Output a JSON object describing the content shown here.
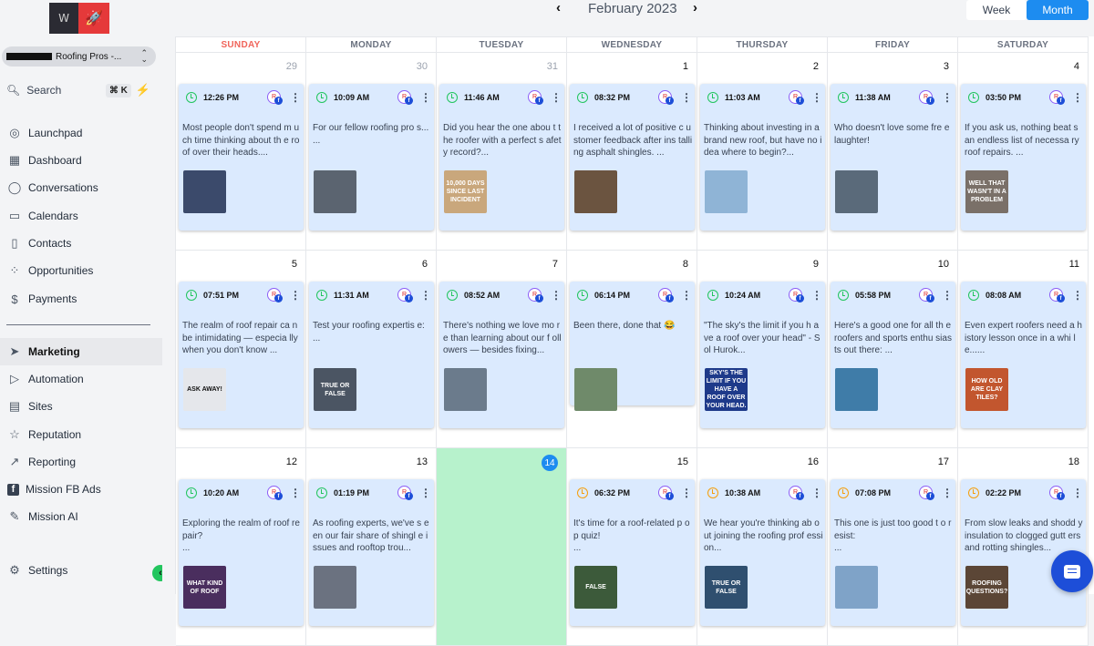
{
  "sidebar": {
    "logo_text": "W",
    "account": "Roofing Pros -...",
    "search_label": "Search",
    "search_shortcut": "⌘ K",
    "nav": [
      {
        "label": "Launchpad",
        "icon": "launchpad-icon"
      },
      {
        "label": "Dashboard",
        "icon": "dashboard-icon"
      },
      {
        "label": "Conversations",
        "icon": "chat-icon"
      },
      {
        "label": "Calendars",
        "icon": "calendar-icon"
      },
      {
        "label": "Contacts",
        "icon": "contacts-icon"
      },
      {
        "label": "Opportunities",
        "icon": "opportunities-icon"
      },
      {
        "label": "Payments",
        "icon": "payments-icon"
      }
    ],
    "nav2": [
      {
        "label": "Marketing",
        "icon": "send-icon",
        "active": true
      },
      {
        "label": "Automation",
        "icon": "automation-icon"
      },
      {
        "label": "Sites",
        "icon": "sites-icon"
      },
      {
        "label": "Reputation",
        "icon": "star-icon"
      },
      {
        "label": "Reporting",
        "icon": "reporting-icon"
      },
      {
        "label": "Mission FB Ads",
        "icon": "facebook-icon"
      },
      {
        "label": "Mission AI",
        "icon": "pencil-icon"
      }
    ],
    "settings_label": "Settings"
  },
  "header": {
    "month_label": "February 2023",
    "week_label": "Week",
    "month_button": "Month"
  },
  "days_of_week": [
    "SUNDAY",
    "MONDAY",
    "TUESDAY",
    "WEDNESDAY",
    "THURSDAY",
    "FRIDAY",
    "SATURDAY"
  ],
  "weeks": [
    [
      {
        "day": "29",
        "other": true,
        "post": {
          "time": "12:26 PM",
          "text": "Most people don't spend m uch time thinking about th e roof over their heads....",
          "img_text": "",
          "img_color": "#3b4a6b",
          "status": "green"
        }
      },
      {
        "day": "30",
        "other": true,
        "post": {
          "time": "10:09 AM",
          "text": "For our fellow roofing pro s...\n...",
          "img_text": "",
          "img_color": "#5b6470",
          "status": "green"
        }
      },
      {
        "day": "31",
        "other": true,
        "post": {
          "time": "11:46 AM",
          "text": "Did you hear the one abou t the roofer with a perfect s afety record?...",
          "img_text": "10,000 DAYS SINCE LAST INCIDENT",
          "img_color": "#c9a77c",
          "status": "green"
        }
      },
      {
        "day": "1",
        "post": {
          "time": "08:32 PM",
          "text": "I received a lot of positive c ustomer feedback after ins talling asphalt shingles. ...",
          "img_text": "",
          "img_color": "#6b5440",
          "status": "green"
        }
      },
      {
        "day": "2",
        "post": {
          "time": "11:03 AM",
          "text": "Thinking about investing in a brand new roof, but have no idea where to begin?...",
          "img_text": "",
          "img_color": "#8fb4d6",
          "status": "green"
        }
      },
      {
        "day": "3",
        "post": {
          "time": "11:38 AM",
          "text": "Who doesn't love some fre e laughter!",
          "img_text": "",
          "img_color": "#5a6a7a",
          "status": "green"
        }
      },
      {
        "day": "4",
        "post": {
          "time": "03:50 PM",
          "text": "If you ask us, nothing beat s an endless list of necessa ry roof repairs. ...",
          "img_text": "WELL THAT WASN'T IN A PROBLEM",
          "img_color": "#7a7068",
          "status": "green"
        }
      }
    ],
    [
      {
        "day": "5",
        "post": {
          "time": "07:51 PM",
          "text": "The realm of roof repair ca n be intimidating — especia lly when you don't know ...",
          "img_text": "ASK AWAY!",
          "img_color": "#e5e7eb",
          "status": "green"
        }
      },
      {
        "day": "6",
        "post": {
          "time": "11:31 AM",
          "text": "Test your roofing expertis e:\n...",
          "img_text": "TRUE OR FALSE",
          "img_color": "#4b5563",
          "status": "green"
        }
      },
      {
        "day": "7",
        "post": {
          "time": "08:52 AM",
          "text": "There's nothing we love mo re than learning about our f ollowers — besides fixing...",
          "img_text": "",
          "img_color": "#6b7b8c",
          "status": "green"
        }
      },
      {
        "day": "8",
        "post": {
          "time": "06:14 PM",
          "text": "Been there, done that 😂",
          "img_text": "",
          "img_color": "#6f8a6a",
          "status": "green"
        }
      },
      {
        "day": "9",
        "post": {
          "time": "10:24 AM",
          "text": "\"The sky's the limit if you h ave a roof over your head\" - Sol Hurok...",
          "img_text": "SKY'S THE LIMIT IF YOU HAVE A ROOF OVER YOUR HEAD.",
          "img_color": "#1e3a8a",
          "status": "green"
        }
      },
      {
        "day": "10",
        "post": {
          "time": "05:58 PM",
          "text": "Here's a good one for all th e roofers and sports enthu siasts out there: ...",
          "img_text": "",
          "img_color": "#3f7ca8",
          "status": "green"
        }
      },
      {
        "day": "11",
        "post": {
          "time": "08:08 AM",
          "text": "Even expert roofers need a history lesson once in a whi le......",
          "img_text": "HOW OLD ARE CLAY TILES?",
          "img_color": "#c2562e",
          "status": "green"
        }
      }
    ],
    [
      {
        "day": "12",
        "post": {
          "time": "10:20 AM",
          "text": "Exploring the realm of roof repair?\n...",
          "img_text": "WHAT KIND OF ROOF",
          "img_color": "#4a2e5e",
          "status": "green"
        }
      },
      {
        "day": "13",
        "post": {
          "time": "01:19 PM",
          "text": "As roofing experts, we've s een our fair share of shingl e issues and rooftop trou...",
          "img_text": "",
          "img_color": "#6b7280",
          "status": "green"
        }
      },
      {
        "day": "14",
        "today": true
      },
      {
        "day": "15",
        "post": {
          "time": "06:32 PM",
          "text": "It's time for a roof-related p op quiz!\n...",
          "img_text": "FALSE",
          "img_color": "#3c5a3a",
          "status": "orange"
        }
      },
      {
        "day": "16",
        "post": {
          "time": "10:38 AM",
          "text": "We hear you're thinking ab out joining the roofing prof ession...",
          "img_text": "TRUE OR FALSE",
          "img_color": "#2f4f6f",
          "status": "orange"
        }
      },
      {
        "day": "17",
        "post": {
          "time": "07:08 PM",
          "text": "This one is just too good t o resist:\n...",
          "img_text": "",
          "img_color": "#7fa3c8",
          "status": "orange"
        }
      },
      {
        "day": "18",
        "post": {
          "time": "02:22 PM",
          "text": "From slow leaks and shodd y insulation to clogged gutt ers and rotting shingles...",
          "img_text": "ROOFING QUESTIONS?",
          "img_color": "#5b4636",
          "status": "orange"
        }
      }
    ]
  ]
}
